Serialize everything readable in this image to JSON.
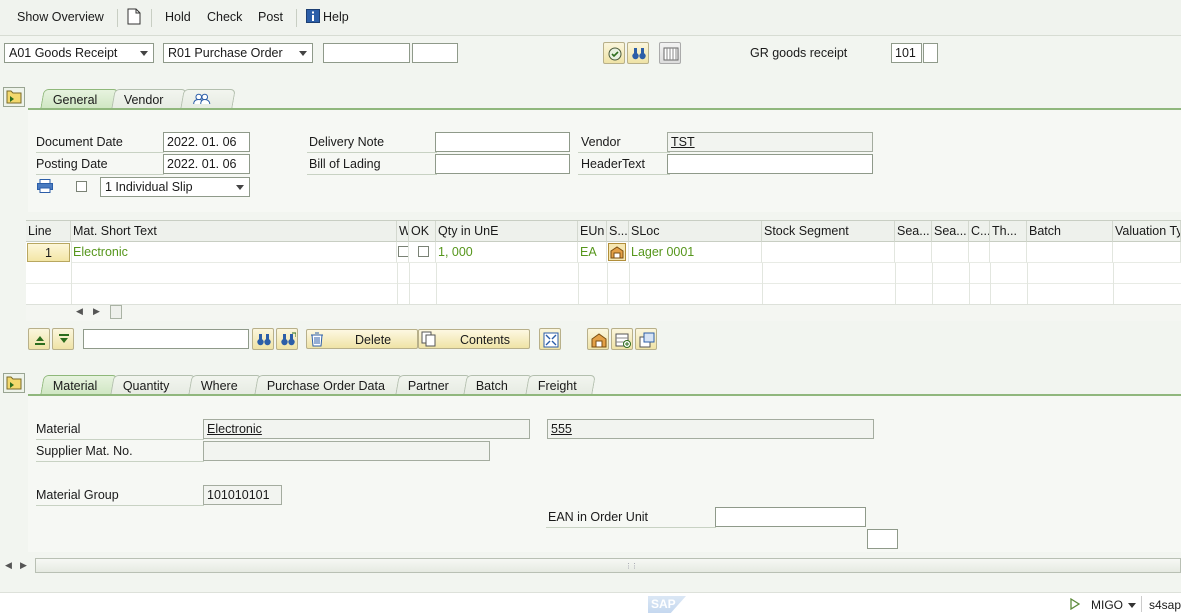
{
  "toolbar": {
    "show_overview": "Show Overview",
    "hold": "Hold",
    "check": "Check",
    "post": "Post",
    "help": "Help"
  },
  "header": {
    "action": "A01 Goods Receipt",
    "reference": "R01 Purchase Order",
    "ref_input_1": "",
    "ref_input_2": "",
    "gr_label": "GR goods receipt",
    "movement_type": "101",
    "movement_extra": ""
  },
  "header_tabs": [
    {
      "label": "General",
      "active": true
    },
    {
      "label": "Vendor",
      "active": false
    },
    {
      "label": "",
      "icon": "partner-icon",
      "active": false
    }
  ],
  "general": {
    "document_date_label": "Document Date",
    "document_date": "2022. 01. 06",
    "posting_date_label": "Posting Date",
    "posting_date": "2022. 01. 06",
    "slip_option": "1 Individual Slip",
    "delivery_note_label": "Delivery Note",
    "delivery_note": "",
    "bill_of_lading_label": "Bill of Lading",
    "bill_of_lading": "",
    "vendor_label": "Vendor",
    "vendor": "TST",
    "header_text_label": "HeaderText",
    "header_text": ""
  },
  "items_table": {
    "columns": [
      "Line",
      "Mat. Short Text",
      "W",
      "OK",
      "Qty in UnE",
      "EUn",
      "S...",
      "SLoc",
      "Stock Segment",
      "Sea...",
      "Sea...",
      "C...",
      "Th...",
      "Batch",
      "Valuation Ty"
    ],
    "rows": [
      {
        "line": "1",
        "mat_short_text": "Electronic",
        "qty": "1, 000",
        "eun": "EA",
        "sloc": "Lager 0001"
      }
    ]
  },
  "item_toolbar": {
    "search_value": "",
    "delete_label": "Delete",
    "contents_label": "Contents"
  },
  "detail_tabs": [
    {
      "label": "Material",
      "active": true
    },
    {
      "label": "Quantity",
      "active": false
    },
    {
      "label": "Where",
      "active": false
    },
    {
      "label": "Purchase Order Data",
      "active": false
    },
    {
      "label": "Partner",
      "active": false
    },
    {
      "label": "Batch",
      "active": false
    },
    {
      "label": "Freight",
      "active": false
    }
  ],
  "material": {
    "material_label": "Material",
    "material_desc": "Electronic",
    "material_number": "555",
    "supplier_mat_label": "Supplier Mat. No.",
    "supplier_mat": "",
    "material_group_label": "Material Group",
    "material_group": "101010101",
    "ean_label": "EAN in Order Unit",
    "ean": "",
    "ean_extra": ""
  },
  "status": {
    "transaction": "MIGO",
    "system": "s4sap",
    "logo": "SAP"
  },
  "colors": {
    "accent_green": "#90b77d",
    "text_green": "#56961c",
    "highlight_red": "#d21d1d"
  }
}
